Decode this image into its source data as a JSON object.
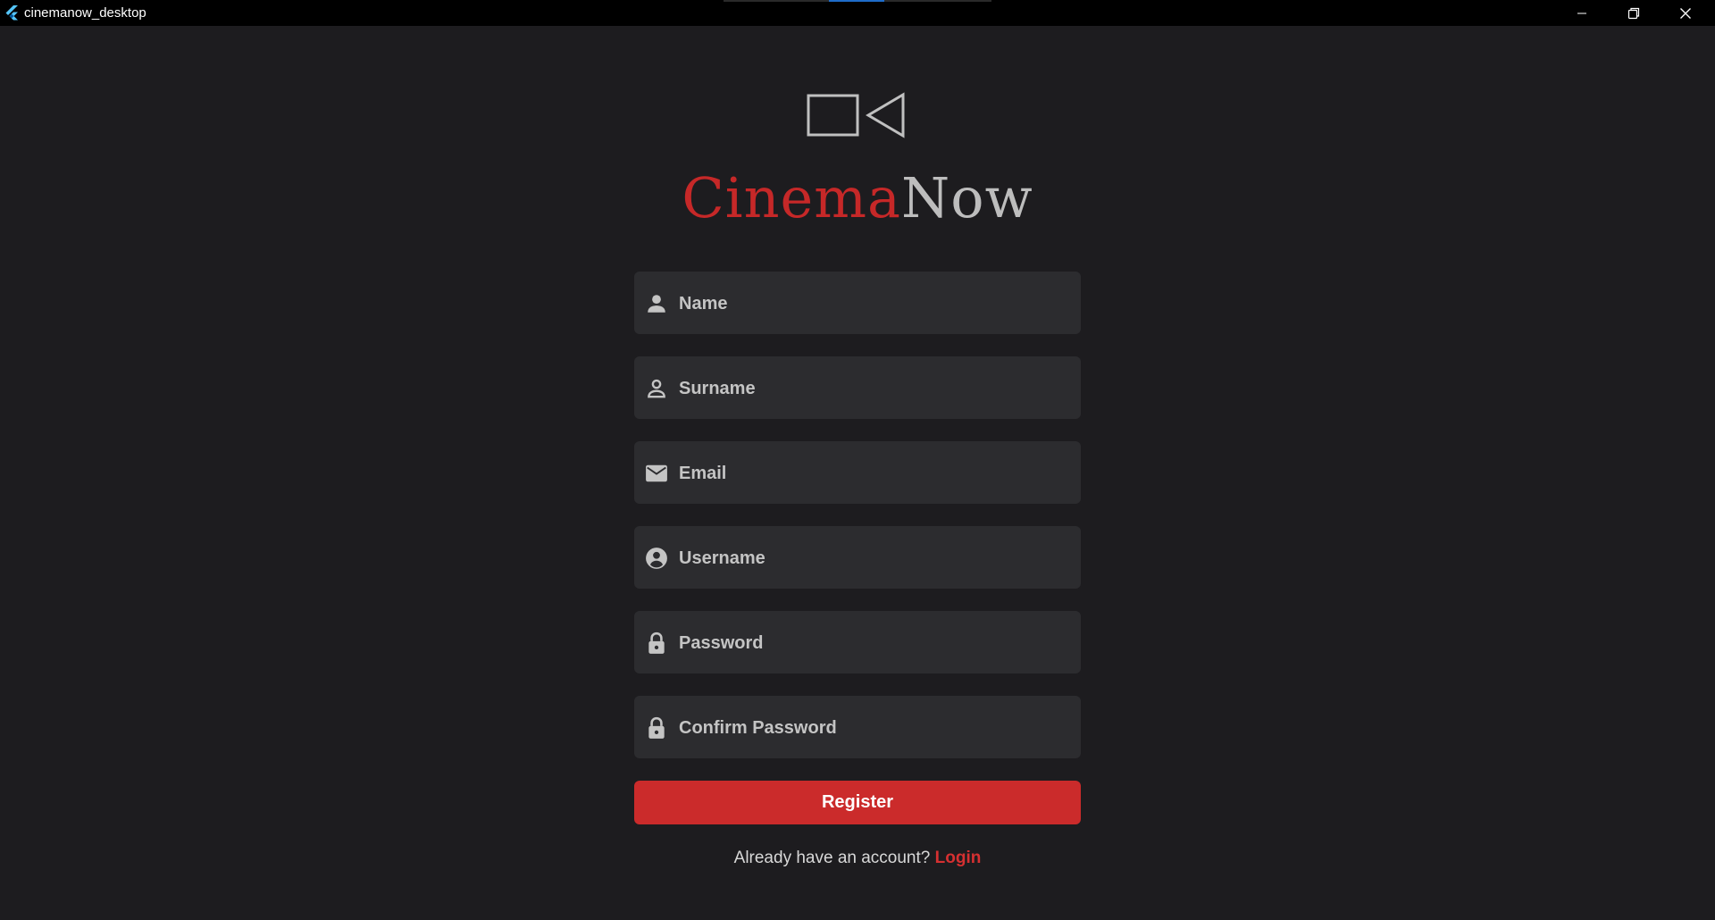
{
  "window": {
    "title": "cinemanow_desktop",
    "icons": [
      "flutter-icon",
      "minimize-icon",
      "restore-icon",
      "close-icon"
    ]
  },
  "brand": {
    "part1": "Cinema",
    "part2": "Now",
    "logo_icon": "video-camera-outline-icon"
  },
  "form": {
    "fields": [
      {
        "label": "Name",
        "icon": "person-filled-icon"
      },
      {
        "label": "Surname",
        "icon": "person-outline-icon"
      },
      {
        "label": "Email",
        "icon": "mail-icon"
      },
      {
        "label": "Username",
        "icon": "account-circle-icon"
      },
      {
        "label": "Password",
        "icon": "lock-icon"
      },
      {
        "label": "Confirm Password",
        "icon": "lock-icon"
      }
    ],
    "register_label": "Register"
  },
  "footer": {
    "text": "Already have an account?",
    "login_label": "Login"
  },
  "colors": {
    "background": "#1d1c1f",
    "field_bg": "#2c2c2f",
    "accent_red": "#cb2b2b",
    "text_grey": "#c4c4c4"
  }
}
